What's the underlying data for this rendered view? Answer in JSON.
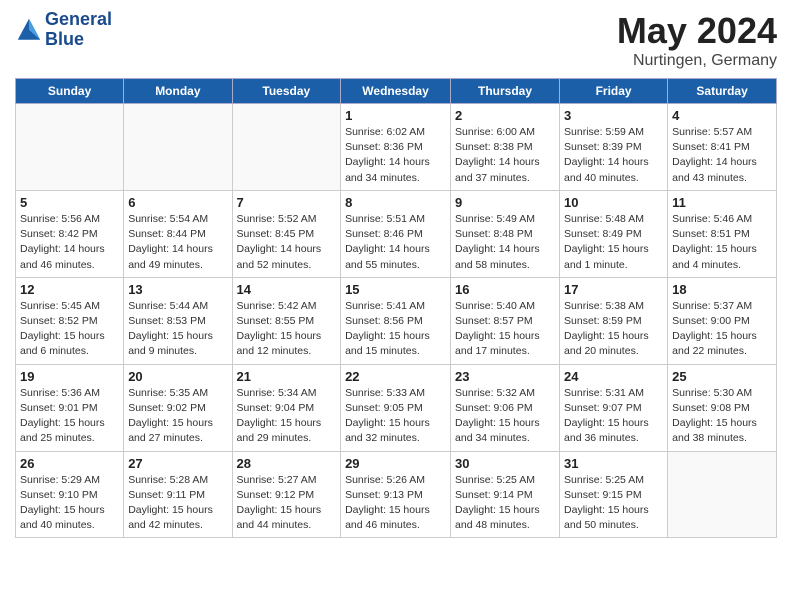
{
  "header": {
    "logo_line1": "General",
    "logo_line2": "Blue",
    "title": "May 2024",
    "subtitle": "Nurtingen, Germany"
  },
  "days_of_week": [
    "Sunday",
    "Monday",
    "Tuesday",
    "Wednesday",
    "Thursday",
    "Friday",
    "Saturday"
  ],
  "weeks": [
    [
      {
        "day": "",
        "info": ""
      },
      {
        "day": "",
        "info": ""
      },
      {
        "day": "",
        "info": ""
      },
      {
        "day": "1",
        "info": "Sunrise: 6:02 AM\nSunset: 8:36 PM\nDaylight: 14 hours\nand 34 minutes."
      },
      {
        "day": "2",
        "info": "Sunrise: 6:00 AM\nSunset: 8:38 PM\nDaylight: 14 hours\nand 37 minutes."
      },
      {
        "day": "3",
        "info": "Sunrise: 5:59 AM\nSunset: 8:39 PM\nDaylight: 14 hours\nand 40 minutes."
      },
      {
        "day": "4",
        "info": "Sunrise: 5:57 AM\nSunset: 8:41 PM\nDaylight: 14 hours\nand 43 minutes."
      }
    ],
    [
      {
        "day": "5",
        "info": "Sunrise: 5:56 AM\nSunset: 8:42 PM\nDaylight: 14 hours\nand 46 minutes."
      },
      {
        "day": "6",
        "info": "Sunrise: 5:54 AM\nSunset: 8:44 PM\nDaylight: 14 hours\nand 49 minutes."
      },
      {
        "day": "7",
        "info": "Sunrise: 5:52 AM\nSunset: 8:45 PM\nDaylight: 14 hours\nand 52 minutes."
      },
      {
        "day": "8",
        "info": "Sunrise: 5:51 AM\nSunset: 8:46 PM\nDaylight: 14 hours\nand 55 minutes."
      },
      {
        "day": "9",
        "info": "Sunrise: 5:49 AM\nSunset: 8:48 PM\nDaylight: 14 hours\nand 58 minutes."
      },
      {
        "day": "10",
        "info": "Sunrise: 5:48 AM\nSunset: 8:49 PM\nDaylight: 15 hours\nand 1 minute."
      },
      {
        "day": "11",
        "info": "Sunrise: 5:46 AM\nSunset: 8:51 PM\nDaylight: 15 hours\nand 4 minutes."
      }
    ],
    [
      {
        "day": "12",
        "info": "Sunrise: 5:45 AM\nSunset: 8:52 PM\nDaylight: 15 hours\nand 6 minutes."
      },
      {
        "day": "13",
        "info": "Sunrise: 5:44 AM\nSunset: 8:53 PM\nDaylight: 15 hours\nand 9 minutes."
      },
      {
        "day": "14",
        "info": "Sunrise: 5:42 AM\nSunset: 8:55 PM\nDaylight: 15 hours\nand 12 minutes."
      },
      {
        "day": "15",
        "info": "Sunrise: 5:41 AM\nSunset: 8:56 PM\nDaylight: 15 hours\nand 15 minutes."
      },
      {
        "day": "16",
        "info": "Sunrise: 5:40 AM\nSunset: 8:57 PM\nDaylight: 15 hours\nand 17 minutes."
      },
      {
        "day": "17",
        "info": "Sunrise: 5:38 AM\nSunset: 8:59 PM\nDaylight: 15 hours\nand 20 minutes."
      },
      {
        "day": "18",
        "info": "Sunrise: 5:37 AM\nSunset: 9:00 PM\nDaylight: 15 hours\nand 22 minutes."
      }
    ],
    [
      {
        "day": "19",
        "info": "Sunrise: 5:36 AM\nSunset: 9:01 PM\nDaylight: 15 hours\nand 25 minutes."
      },
      {
        "day": "20",
        "info": "Sunrise: 5:35 AM\nSunset: 9:02 PM\nDaylight: 15 hours\nand 27 minutes."
      },
      {
        "day": "21",
        "info": "Sunrise: 5:34 AM\nSunset: 9:04 PM\nDaylight: 15 hours\nand 29 minutes."
      },
      {
        "day": "22",
        "info": "Sunrise: 5:33 AM\nSunset: 9:05 PM\nDaylight: 15 hours\nand 32 minutes."
      },
      {
        "day": "23",
        "info": "Sunrise: 5:32 AM\nSunset: 9:06 PM\nDaylight: 15 hours\nand 34 minutes."
      },
      {
        "day": "24",
        "info": "Sunrise: 5:31 AM\nSunset: 9:07 PM\nDaylight: 15 hours\nand 36 minutes."
      },
      {
        "day": "25",
        "info": "Sunrise: 5:30 AM\nSunset: 9:08 PM\nDaylight: 15 hours\nand 38 minutes."
      }
    ],
    [
      {
        "day": "26",
        "info": "Sunrise: 5:29 AM\nSunset: 9:10 PM\nDaylight: 15 hours\nand 40 minutes."
      },
      {
        "day": "27",
        "info": "Sunrise: 5:28 AM\nSunset: 9:11 PM\nDaylight: 15 hours\nand 42 minutes."
      },
      {
        "day": "28",
        "info": "Sunrise: 5:27 AM\nSunset: 9:12 PM\nDaylight: 15 hours\nand 44 minutes."
      },
      {
        "day": "29",
        "info": "Sunrise: 5:26 AM\nSunset: 9:13 PM\nDaylight: 15 hours\nand 46 minutes."
      },
      {
        "day": "30",
        "info": "Sunrise: 5:25 AM\nSunset: 9:14 PM\nDaylight: 15 hours\nand 48 minutes."
      },
      {
        "day": "31",
        "info": "Sunrise: 5:25 AM\nSunset: 9:15 PM\nDaylight: 15 hours\nand 50 minutes."
      },
      {
        "day": "",
        "info": ""
      }
    ]
  ]
}
